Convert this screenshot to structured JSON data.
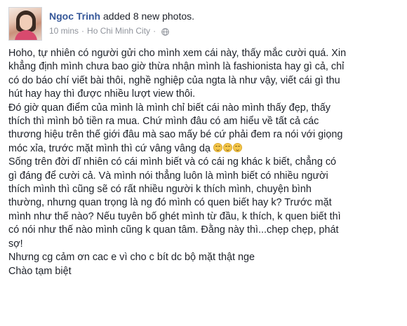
{
  "post": {
    "author": "Ngoc Trinh",
    "action": "added 8 new photos.",
    "time": "10 mins",
    "separator": "·",
    "location": "Ho Chi Minh City",
    "separator2": "·",
    "privacy_icon": "globe-icon",
    "paragraphs": [
      "Hoho, tự nhiên có người gửi cho mình xem cái này, thấy mắc cười quá. Xin\nkhẳng định mình chưa bao giờ thừa nhận mình là fashionista hay gì cả, chỉ\ncó do báo chí viết bài thôi, nghề nghiệp của ngta là như vậy, viết cái gì thu\nhút hay hay thì được nhiều lượt view thôi.",
      "Đó giờ quan điểm của mình là mình chỉ biết cái nào mình thấy đẹp, thấy\nthích thì mình bỏ tiền ra mua. Chứ mình đâu có am hiểu về tất cả các\nthương hiệu trên thế giới đâu mà sao mấy bé cứ phải đem ra nói với giọng\nmóc xỉa, trước mặt mình thì cứ vâng vâng dạ ",
      "Sống trên đời dĩ nhiên có cái mình biết và có cái ng khác k biết, chẳng có\ngì đáng để cười cả. Và mình nói thẳng luôn là mình biết có nhiều người\nthích mình thì cũng sẽ có rất nhiều người k thích mình, chuyện bình\nthường, nhưng quan trọng là ng đó mình có quen biết hay k? Trước mặt\nmình như thế nào? Nếu tuyên bố ghét mình từ đầu, k thích, k quen biết thì\ncó nói như thế nào mình cũng k quan tâm. Đằng này thì...chẹp chẹp, phát\nsợ!",
      "Nhưng cg cảm ơn cac e vì cho c bít dc bộ mặt thật nge",
      "Chào tạm biệt"
    ],
    "emoji_icon": "grinning-emoji-icon",
    "emoji_count": 3
  }
}
